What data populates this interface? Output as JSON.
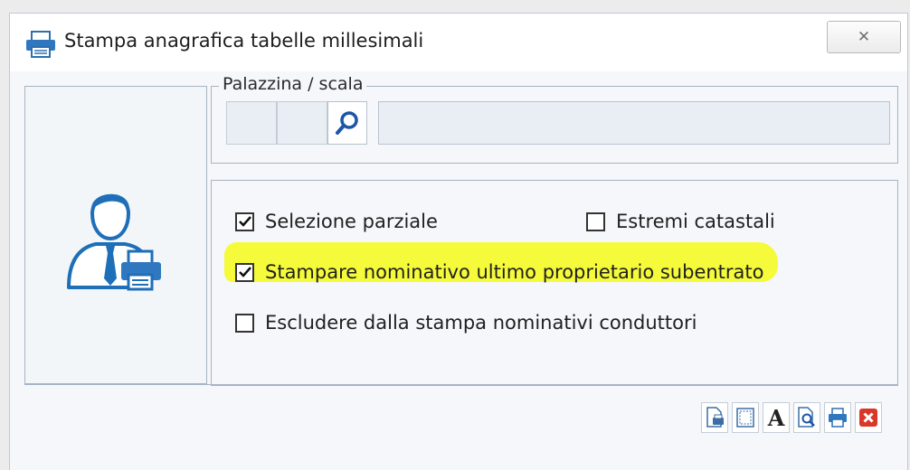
{
  "window": {
    "title": "Stampa anagrafica tabelle millesimali",
    "close_label": "✕"
  },
  "palazzina": {
    "legend": "Palazzina / scala",
    "code_part1": "",
    "code_part2": "",
    "description": ""
  },
  "options": {
    "selezione_parziale": {
      "label": "Selezione parziale",
      "checked": true
    },
    "estremi_catastali": {
      "label": "Estremi catastali",
      "checked": false
    },
    "stampare_nominativo": {
      "label": "Stampare nominativo ultimo proprietario subentrato",
      "checked": true,
      "highlight": true
    },
    "escludere_conduttori": {
      "label": "Escludere dalla stampa nominativi conduttori",
      "checked": false
    }
  },
  "toolbar": {
    "buttons": [
      "page-setup-icon",
      "margins-icon",
      "font-icon",
      "print-preview-icon",
      "printer-icon",
      "close-red-icon"
    ]
  },
  "colors": {
    "highlight": "#f5fb3a",
    "accent_blue": "#1f6fb8",
    "close_red": "#d9372a"
  }
}
